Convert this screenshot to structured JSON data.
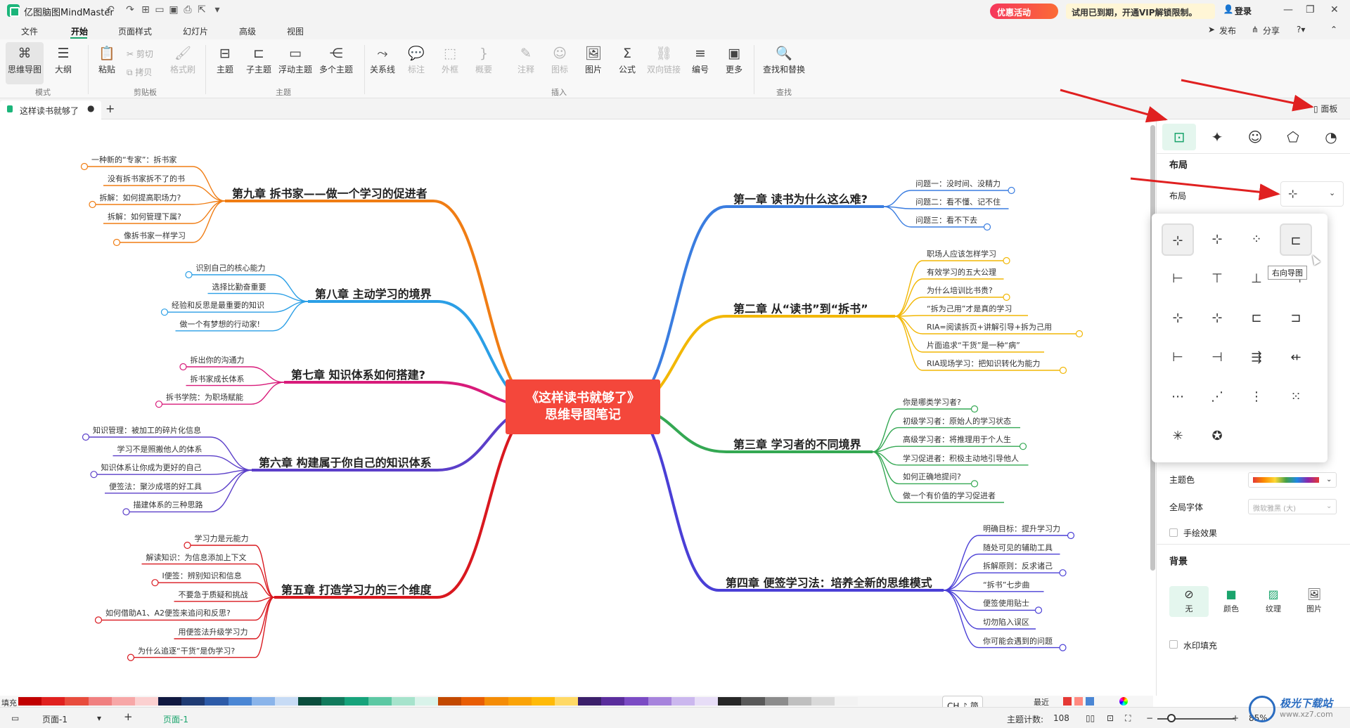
{
  "app": {
    "name": "亿图脑图MindMaster",
    "promo": "优惠活动",
    "vip_notice": "试用已到期，开通VIP解锁限制。",
    "login": "登录"
  },
  "menu": {
    "items": [
      "文件",
      "开始",
      "页面样式",
      "幻灯片",
      "高级",
      "视图"
    ],
    "active": "开始",
    "right": [
      "发布",
      "分享"
    ]
  },
  "ribbon": {
    "mode": [
      "思维导图",
      "大纲"
    ],
    "clipboard": {
      "paste": "粘贴",
      "cut": "剪切",
      "copy": "拷贝",
      "format_painter": "格式刷"
    },
    "topic": [
      "主题",
      "子主题",
      "浮动主题",
      "多个主题"
    ],
    "insert": [
      "关系线",
      "标注",
      "外框",
      "概要",
      "注释",
      "图标",
      "图片",
      "公式",
      "双向链接",
      "编号",
      "更多"
    ],
    "find": "查找和替换",
    "groups": [
      "模式",
      "剪贴板",
      "主题",
      "插入",
      "查找"
    ]
  },
  "tabs": {
    "document": "这样读书就够了",
    "panel_toggle": "面板"
  },
  "mindmap": {
    "center": [
      "《这样读书就够了》",
      "思维导图笔记"
    ],
    "branches": [
      {
        "title": "第一章 读书为什么这么难?",
        "color": "#3a7de0",
        "children": [
          "问题一：没时间、没精力",
          "问题二：看不懂、记不住",
          "问题三：看不下去"
        ]
      },
      {
        "title": "第二章 从“读书”到“拆书”",
        "color": "#f2b705",
        "children": [
          "职场人应该怎样学习",
          "有效学习的五大公理",
          "为什么培训比书贵?",
          "“拆为己用”才是真的学习",
          "RIA=阅读拆页+讲解引导+拆为己用",
          "片面追求“干货”是一种“病”",
          "RIA现场学习：把知识转化为能力"
        ]
      },
      {
        "title": "第三章 学习者的不同境界",
        "color": "#34a853",
        "children": [
          "你是哪类学习者?",
          "初级学习者：原始人的学习状态",
          "高级学习者：将推理用于个人生",
          "学习促进者：积极主动地引导他人",
          "如何正确地提问?",
          "做一个有价值的学习促进者"
        ]
      },
      {
        "title": "第四章 便签学习法：培养全新的思维模式",
        "color": "#4a3fd6",
        "children": [
          "明确目标：提升学习力",
          "随处可见的辅助工具",
          "拆解原则：反求诸己",
          "“拆书”七步曲",
          "便签使用贴士",
          "切勿陷入误区",
          "你可能会遇到的问题"
        ]
      },
      {
        "title": "第五章 打造学习力的三个维度",
        "color": "#d9181f",
        "children": [
          "学习力是元能力",
          "解读知识：为信息添加上下文",
          "I便签：辨别知识和信息",
          "不要急于质疑和挑战",
          "如何借助A1、A2便签来追问和反思?",
          "用便签法升级学习力",
          "为什么追逐“干货”是伪学习?"
        ]
      },
      {
        "title": "第六章 构建属于你自己的知识体系",
        "color": "#5b3fc9",
        "children": [
          "知识管理：被加工的碎片化信息",
          "学习不是照搬他人的体系",
          "知识体系让你成为更好的自己",
          "便签法：聚沙成塔的好工具",
          "描建体系的三种思路"
        ]
      },
      {
        "title": "第七章 知识体系如何搭建?",
        "color": "#d81b7a",
        "children": [
          "拆出你的沟通力",
          "拆书家成长体系",
          "拆书学院：为职场赋能"
        ]
      },
      {
        "title": "第八章 主动学习的境界",
        "color": "#2b9fe6",
        "children": [
          "识别自己的核心能力",
          "选择比勤奋重要",
          "经验和反思是最重要的知识",
          "做一个有梦想的行动家!"
        ]
      },
      {
        "title": "第九章 拆书家——做一个学习的促进者",
        "color": "#f07d14",
        "children": [
          "一种新的“专家”：拆书家",
          "没有拆书家拆不了的书",
          "拆解：如何提高职场力?",
          "拆解：如何管理下属?",
          "像拆书家一样学习"
        ]
      }
    ]
  },
  "panel": {
    "section_layout": "布局",
    "layout_label": "布局",
    "tooltip": "右向导图",
    "theme_color_label": "主题色",
    "global_font_label": "全局字体",
    "global_font_value": "微软雅黑 (大)",
    "hand_drawn": "手绘效果",
    "background": "背景",
    "bg_options": [
      "无",
      "颜色",
      "纹理",
      "图片"
    ],
    "watermark": "水印填充"
  },
  "palette": {
    "label": "填充",
    "recent": "最近",
    "colors": [
      "#c00000",
      "#e0201e",
      "#e84c3d",
      "#f08080",
      "#f7a7a7",
      "#fbd0d0",
      "#101840",
      "#1f3b73",
      "#2d5ba8",
      "#4a86d4",
      "#8ab4ea",
      "#c7dbf5",
      "#0a4d3c",
      "#117a5c",
      "#16a37b",
      "#5cc8a3",
      "#a6e3cc",
      "#d9f3ea",
      "#c24800",
      "#e85d04",
      "#f48c06",
      "#faa307",
      "#ffba08",
      "#ffd966",
      "#3b1f6a",
      "#5a2d9c",
      "#7b4bc4",
      "#a683dc",
      "#cbb7ee",
      "#e7ddf7",
      "#262626",
      "#595959",
      "#8c8c8c",
      "#bfbfbf",
      "#d9d9d9",
      "#f2f2f2"
    ]
  },
  "status": {
    "page_tab": "页面-1",
    "page_tab_active": "页面-1",
    "topic_count_label": "主题计数:",
    "topic_count": "108",
    "zoom": "85%",
    "ime": "CH ♪ 简"
  },
  "watermark_brand": {
    "name": "极光下载站",
    "url": "www.xz7.com"
  }
}
